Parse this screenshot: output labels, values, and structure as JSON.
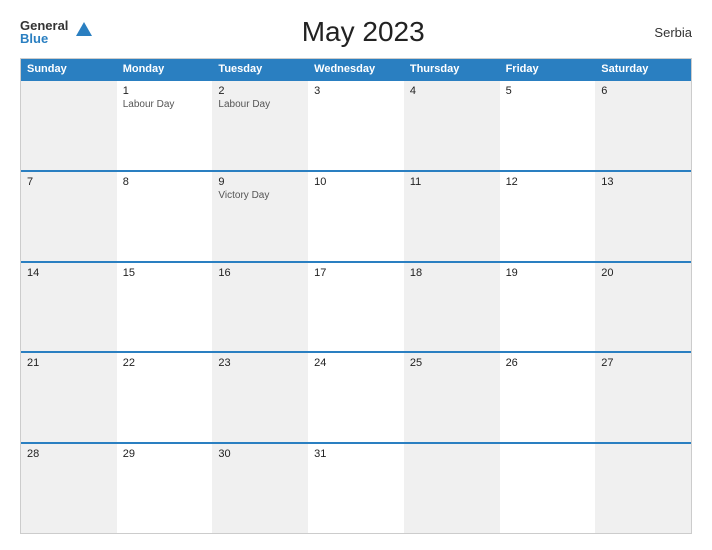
{
  "logo": {
    "text_general": "General",
    "text_blue": "Blue",
    "icon": "▲"
  },
  "title": "May 2023",
  "country": "Serbia",
  "headers": [
    "Sunday",
    "Monday",
    "Tuesday",
    "Wednesday",
    "Thursday",
    "Friday",
    "Saturday"
  ],
  "weeks": [
    [
      {
        "day": "",
        "holiday": ""
      },
      {
        "day": "1",
        "holiday": "Labour Day"
      },
      {
        "day": "2",
        "holiday": "Labour Day"
      },
      {
        "day": "3",
        "holiday": ""
      },
      {
        "day": "4",
        "holiday": ""
      },
      {
        "day": "5",
        "holiday": ""
      },
      {
        "day": "6",
        "holiday": ""
      }
    ],
    [
      {
        "day": "7",
        "holiday": ""
      },
      {
        "day": "8",
        "holiday": ""
      },
      {
        "day": "9",
        "holiday": "Victory Day"
      },
      {
        "day": "10",
        "holiday": ""
      },
      {
        "day": "11",
        "holiday": ""
      },
      {
        "day": "12",
        "holiday": ""
      },
      {
        "day": "13",
        "holiday": ""
      }
    ],
    [
      {
        "day": "14",
        "holiday": ""
      },
      {
        "day": "15",
        "holiday": ""
      },
      {
        "day": "16",
        "holiday": ""
      },
      {
        "day": "17",
        "holiday": ""
      },
      {
        "day": "18",
        "holiday": ""
      },
      {
        "day": "19",
        "holiday": ""
      },
      {
        "day": "20",
        "holiday": ""
      }
    ],
    [
      {
        "day": "21",
        "holiday": ""
      },
      {
        "day": "22",
        "holiday": ""
      },
      {
        "day": "23",
        "holiday": ""
      },
      {
        "day": "24",
        "holiday": ""
      },
      {
        "day": "25",
        "holiday": ""
      },
      {
        "day": "26",
        "holiday": ""
      },
      {
        "day": "27",
        "holiday": ""
      }
    ],
    [
      {
        "day": "28",
        "holiday": ""
      },
      {
        "day": "29",
        "holiday": ""
      },
      {
        "day": "30",
        "holiday": ""
      },
      {
        "day": "31",
        "holiday": ""
      },
      {
        "day": "",
        "holiday": ""
      },
      {
        "day": "",
        "holiday": ""
      },
      {
        "day": "",
        "holiday": ""
      }
    ]
  ],
  "colors": {
    "header_bg": "#2a7fc1",
    "header_text": "#ffffff",
    "accent_blue": "#2a7fc1",
    "cell_gray": "#f0f0f0",
    "cell_white": "#ffffff"
  }
}
